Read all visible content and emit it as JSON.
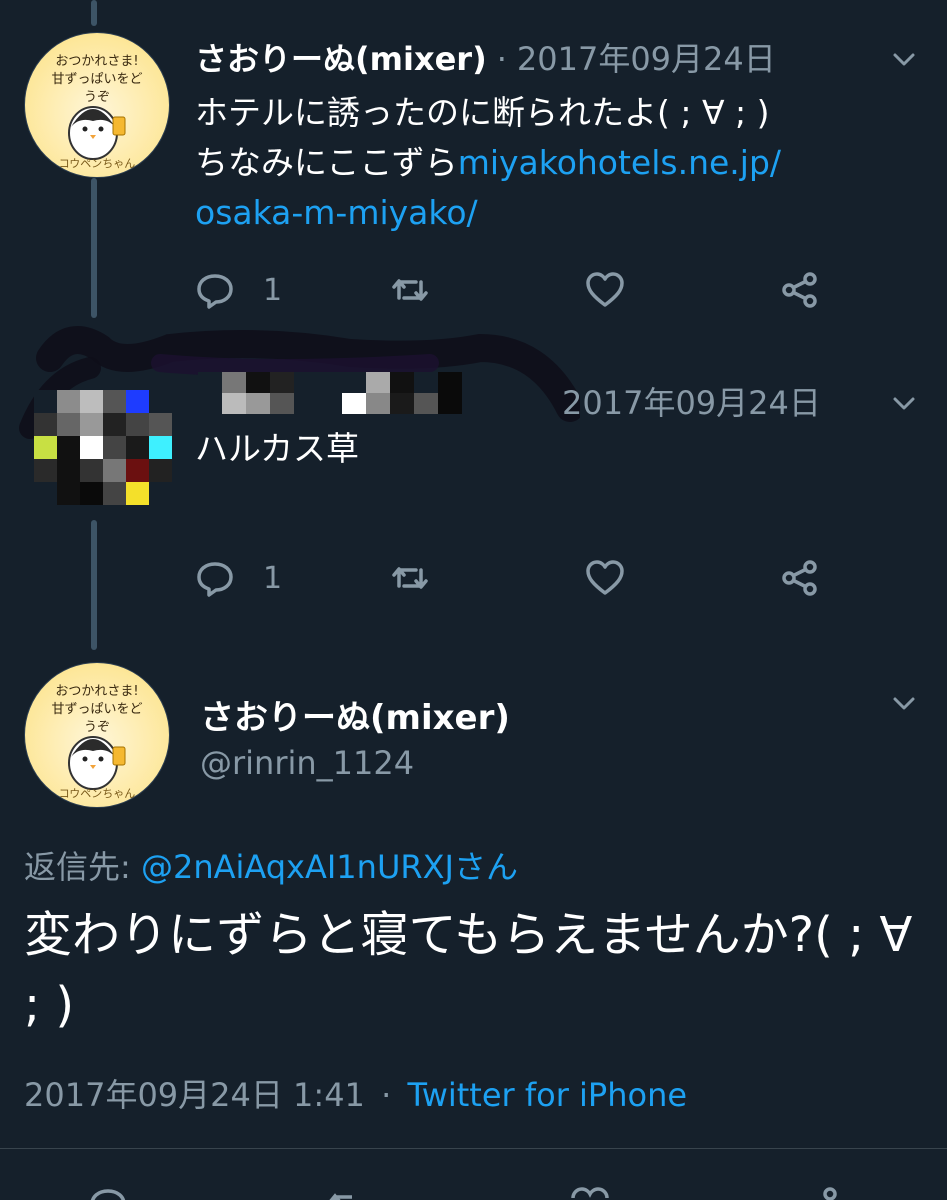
{
  "tweet1": {
    "avatar_caption": "おつかれさま! 甘ずっぱいをどうぞ",
    "avatar_footer": "コウペンちゃん",
    "name": "さおりーぬ(mixer)",
    "separator": "·",
    "date": "2017年09月24日",
    "line1": "ホテルに誘ったのに断られたよ( ; ∀ ; )",
    "line2_prefix": "ちなみにここずら",
    "link_part1": "miyakohotels.ne.jp/",
    "link_part2": "osaka-m-miyako/",
    "reply_count": "1"
  },
  "tweet2": {
    "date": "2017年09月24日",
    "text": "ハルカス草",
    "reply_count": "1"
  },
  "tweet3": {
    "avatar_caption": "おつかれさま! 甘ずっぱいをどうぞ",
    "avatar_footer": "コウペンちゃん",
    "name": "さおりーぬ(mixer)",
    "handle": "@rinrin_1124",
    "reply_label": "返信先: ",
    "reply_to": "@2nAiAqxAI1nURXJさん",
    "text": "変わりにずらと寝てもらえませんか?( ; ∀ ; )",
    "timestamp": "2017年09月24日 1:41",
    "separator": "·",
    "source": "Twitter for iPhone"
  },
  "colors": {
    "background": "#15202b",
    "link": "#1da1f2",
    "secondary_text": "#8899a6",
    "thread_line": "#3d5466"
  },
  "icons": [
    "reply-icon",
    "retweet-icon",
    "like-icon",
    "share-icon",
    "chevron-down-icon"
  ]
}
